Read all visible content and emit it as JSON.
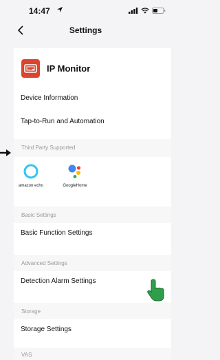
{
  "status_bar": {
    "time": "14:47",
    "icons": [
      "location-arrow-icon",
      "signal-icon",
      "wifi-icon",
      "battery-icon"
    ]
  },
  "nav": {
    "title": "Settings",
    "back_icon": "chevron-left-icon"
  },
  "device": {
    "name": "IP Monitor",
    "icon": "monitor-icon",
    "icon_color": "#d9452f"
  },
  "rows": {
    "device_information": "Device Information",
    "tap_to_run": "Tap-to-Run and Automation",
    "basic_function": "Basic Function Settings",
    "detection_alarm": "Detection Alarm Settings",
    "storage": "Storage Settings"
  },
  "sections": {
    "third_party": "Third Party Supported",
    "basic": "Basic Settings",
    "advanced": "Advanced Settings",
    "storage": "Storage",
    "vas": "VAS"
  },
  "third_party_services": [
    {
      "label": "amazon echo",
      "icon": "alexa-ring-icon",
      "color": "#31c4f3"
    },
    {
      "label": "GoogleHome",
      "icon": "google-assistant-icon",
      "colors": [
        "#4285f4",
        "#ea4335",
        "#fbbc05",
        "#34a853"
      ]
    }
  ],
  "annotations": {
    "pointer_arrow": "arrow-right-icon",
    "hand_cursor": "pointing-hand-icon",
    "hand_color": "#2e9e4a"
  }
}
